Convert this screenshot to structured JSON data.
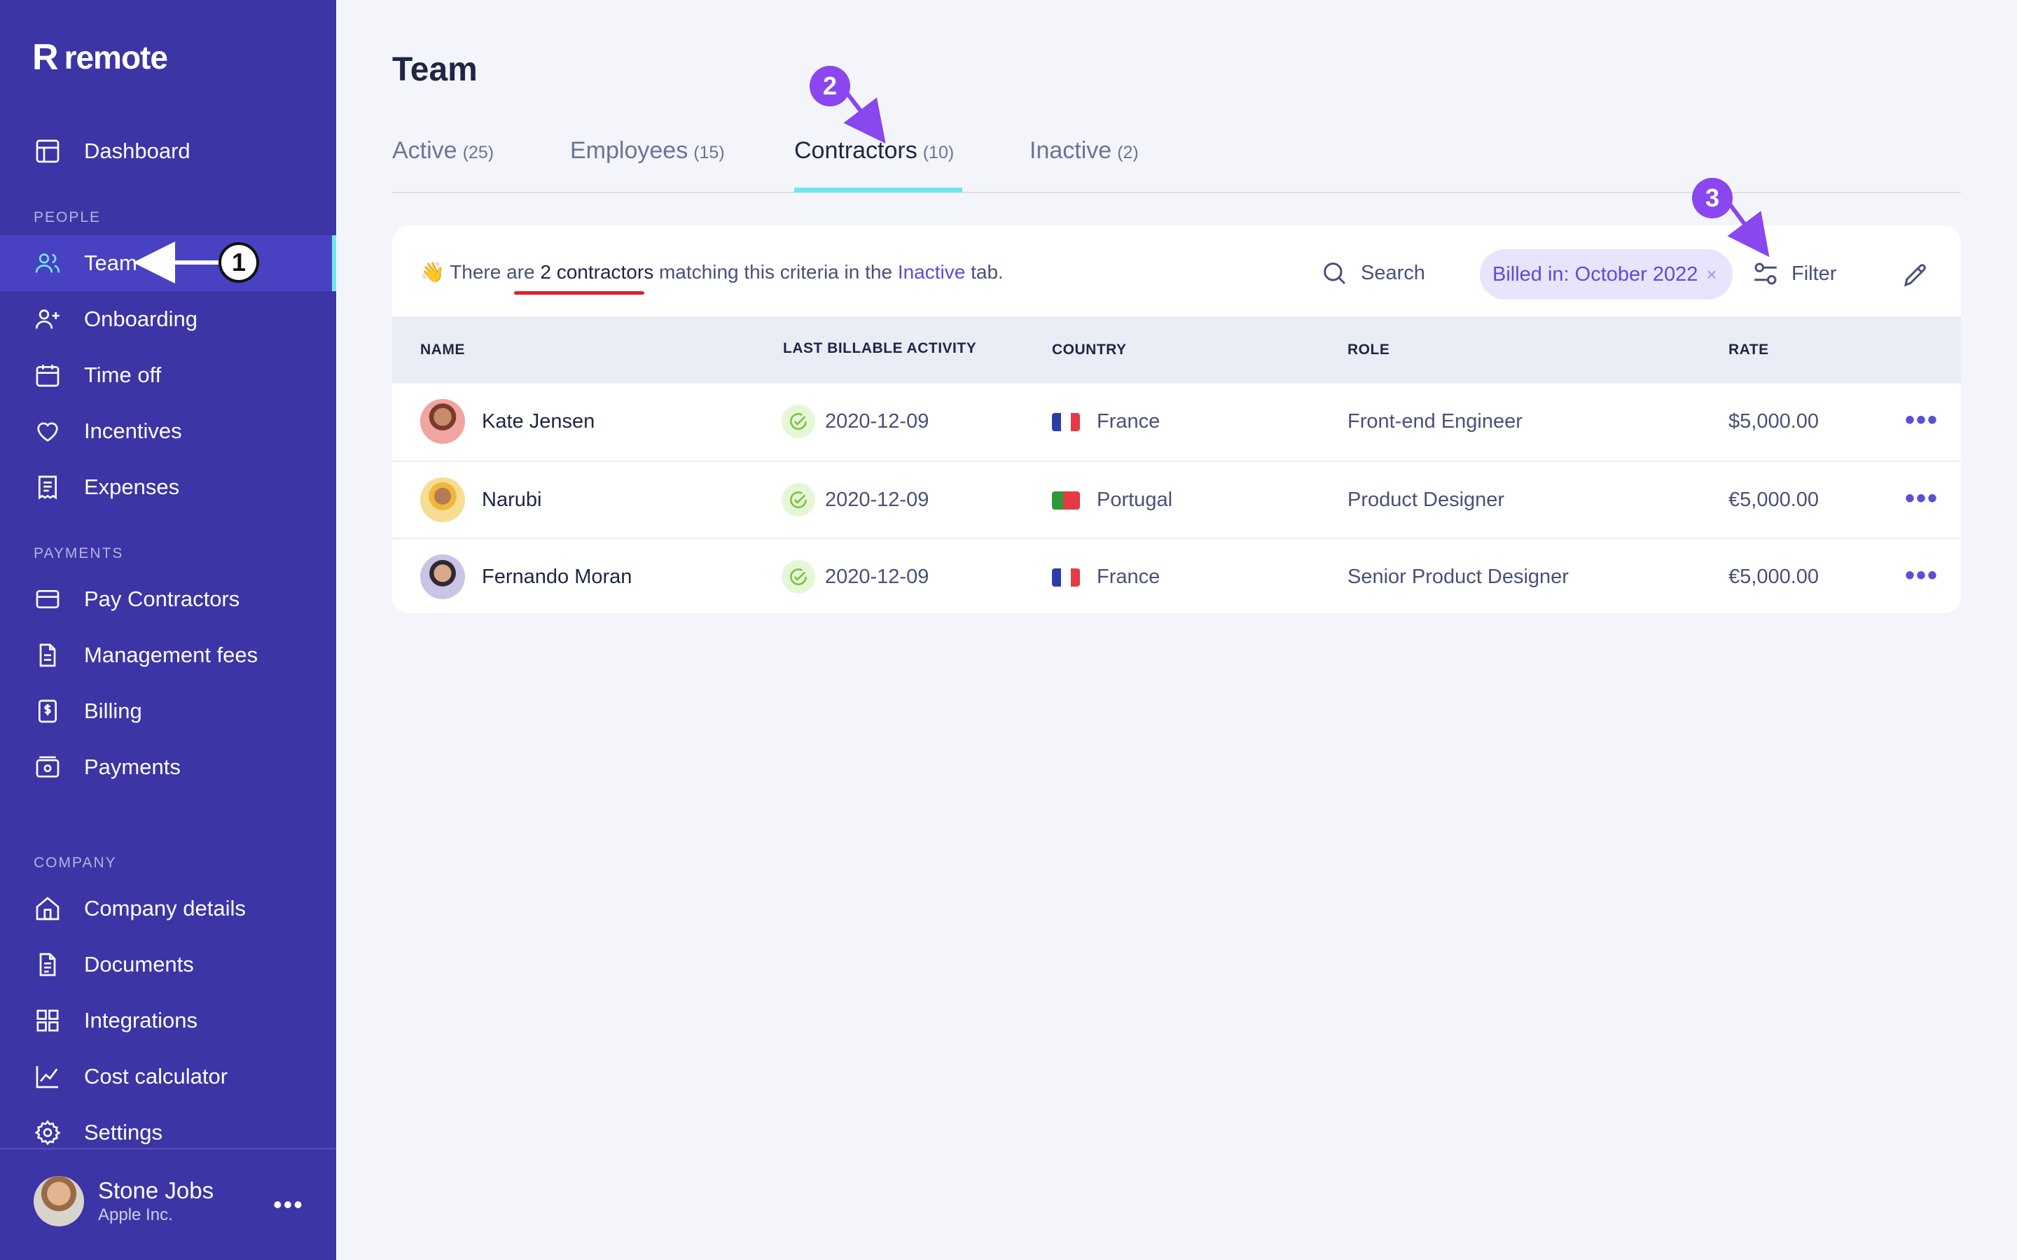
{
  "sidebar": {
    "logo_mark": "R",
    "logo_text": "remote",
    "sections": {
      "people": "PEOPLE",
      "payments": "PAYMENTS",
      "company": "COMPANY"
    },
    "items": {
      "dashboard": "Dashboard",
      "team": "Team",
      "onboarding": "Onboarding",
      "time_off": "Time off",
      "incentives": "Incentives",
      "expenses": "Expenses",
      "pay_contractors": "Pay Contractors",
      "management_fees": "Management fees",
      "billing": "Billing",
      "payments": "Payments",
      "company_details": "Company details",
      "documents": "Documents",
      "integrations": "Integrations",
      "cost_calculator": "Cost calculator",
      "settings": "Settings"
    },
    "user": {
      "name": "Stone Jobs",
      "company": "Apple Inc.",
      "more": "•••"
    },
    "colors": {
      "background": "#3b35a6",
      "active_bg": "#4841c2",
      "active_accent": "#72e6ee"
    }
  },
  "main": {
    "title": "Team",
    "tabs": [
      {
        "label": "Active",
        "count": "(25)"
      },
      {
        "label": "Employees",
        "count": "(15)"
      },
      {
        "label": "Contractors",
        "count": "(10)"
      },
      {
        "label": "Inactive",
        "count": "(2)"
      }
    ],
    "notice": {
      "emoji": "👋",
      "prefix": "There are",
      "highlight": "2 contractors",
      "middle": "matching this criteria in the",
      "link": "Inactive",
      "suffix": "tab."
    },
    "search_label": "Search",
    "filter_chip": "Billed in: October 2022",
    "filter_chip_close": "×",
    "filter_label": "Filter",
    "table": {
      "headers": {
        "name": "NAME",
        "activity": "LAST BILLABLE ACTIVITY",
        "country": "COUNTRY",
        "role": "ROLE",
        "rate": "RATE"
      },
      "rows": [
        {
          "name": "Kate Jensen",
          "activity": "2020-12-09",
          "country": "France",
          "role": "Front-end Engineer",
          "rate": "$5,000.00",
          "more": "•••"
        },
        {
          "name": "Narubi",
          "activity": "2020-12-09",
          "country": "Portugal",
          "role": "Product Designer",
          "rate": "€5,000.00",
          "more": "•••"
        },
        {
          "name": "Fernando Moran",
          "activity": "2020-12-09",
          "country": "France",
          "role": "Senior Product Designer",
          "rate": "€5,000.00",
          "more": "•••"
        }
      ]
    }
  },
  "annotations": {
    "one": "1",
    "two": "2",
    "three": "3"
  }
}
